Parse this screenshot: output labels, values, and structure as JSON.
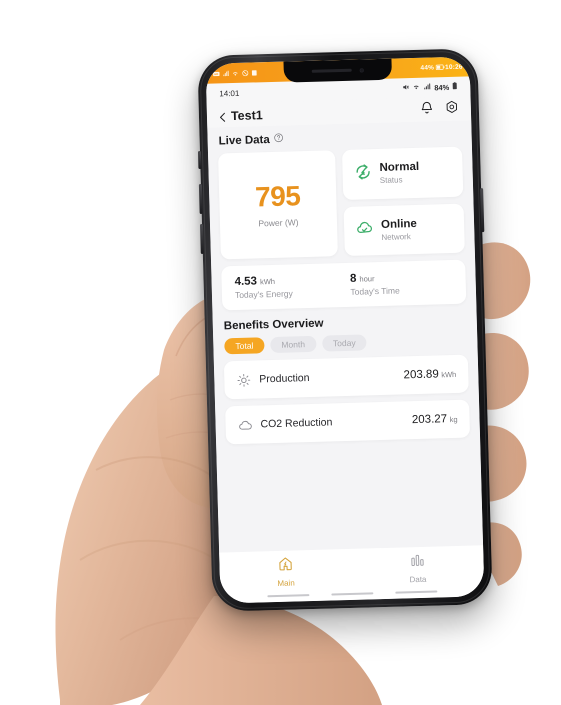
{
  "device_bar": {
    "battery_percent": "44%",
    "clock": "10:26",
    "icons": [
      "hd-icon",
      "signal-icon",
      "wifi-icon",
      "dnd-icon",
      "note-icon",
      "battery-icon"
    ]
  },
  "status_bar": {
    "time": "14:01",
    "battery_percent": "84%",
    "icons": [
      "mute-icon",
      "wifi-icon",
      "signal-icon",
      "battery-icon"
    ]
  },
  "app_bar": {
    "back_icon": "chevron-left-icon",
    "title": "Test1",
    "bell_icon": "bell-icon",
    "settings_icon": "gear-hex-icon"
  },
  "live_data": {
    "section_title": "Live Data",
    "info_icon": "question-circle-icon",
    "power": {
      "value": "795",
      "label": "Power (W)"
    },
    "status": {
      "icon": "refresh-cycle-icon",
      "value": "Normal",
      "label": "Status"
    },
    "network": {
      "icon": "cloud-check-icon",
      "value": "Online",
      "label": "Network"
    },
    "metrics": [
      {
        "value": "4.53",
        "unit": "kWh",
        "label": "Today's Energy"
      },
      {
        "value": "8",
        "unit": "hour",
        "label": "Today's Time"
      }
    ]
  },
  "benefits": {
    "section_title": "Benefits Overview",
    "tabs": [
      {
        "label": "Total",
        "active": true
      },
      {
        "label": "Month",
        "active": false
      },
      {
        "label": "Today",
        "active": false
      }
    ],
    "rows": [
      {
        "icon": "sun-icon",
        "label": "Production",
        "value": "203.89",
        "unit": "kWh"
      },
      {
        "icon": "cloud-icon",
        "label": "CO2 Reduction",
        "value": "203.27",
        "unit": "kg"
      }
    ]
  },
  "tab_bar": {
    "items": [
      {
        "icon": "home-icon",
        "label": "Main",
        "active": true
      },
      {
        "icon": "bar-chart-icon",
        "label": "Data",
        "active": false
      }
    ]
  },
  "colors": {
    "accent_orange": "#E8921E",
    "pill_orange": "#F5A623",
    "status_green": "#3DAE6A",
    "tab_active": "#D4A33C",
    "page_bg": "#F4F4F6"
  }
}
